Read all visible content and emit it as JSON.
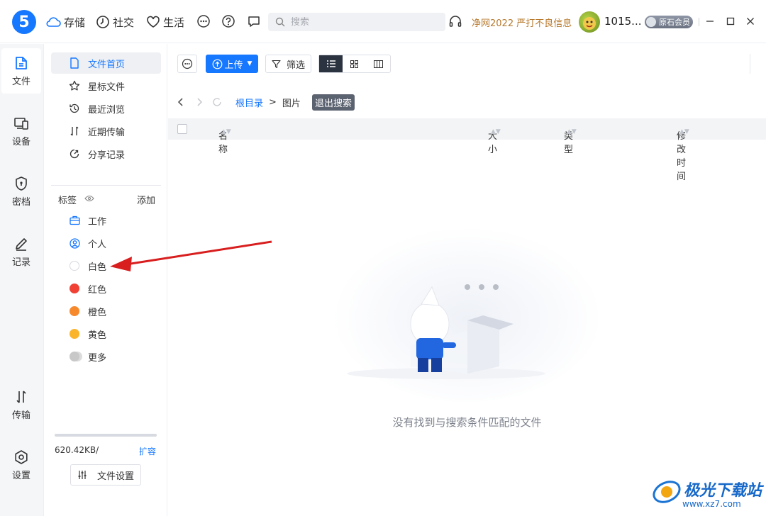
{
  "header": {
    "logo": "5",
    "nav": [
      {
        "label": "存储",
        "icon": "cloud-icon"
      },
      {
        "label": "社交",
        "icon": "clock-icon"
      },
      {
        "label": "生活",
        "icon": "heart-icon"
      }
    ],
    "search_placeholder": "搜索",
    "promo": "净网2022 严打不良信息",
    "username": "1015...",
    "member_badge": "原石会员"
  },
  "rail": {
    "items": [
      {
        "label": "文件",
        "icon": "file-icon",
        "active": true
      },
      {
        "label": "设备",
        "icon": "device-icon"
      },
      {
        "label": "密档",
        "icon": "shield-icon"
      },
      {
        "label": "记录",
        "icon": "pen-icon"
      },
      {
        "label": "传输",
        "icon": "transfer-icon"
      },
      {
        "label": "设置",
        "icon": "gear-icon"
      }
    ]
  },
  "side": {
    "items": [
      {
        "label": "文件首页",
        "icon": "document-icon"
      },
      {
        "label": "星标文件",
        "icon": "star-icon"
      },
      {
        "label": "最近浏览",
        "icon": "history-icon"
      },
      {
        "label": "近期传输",
        "icon": "transfer-icon"
      },
      {
        "label": "分享记录",
        "icon": "share-icon"
      }
    ],
    "tags_title": "标签",
    "tags_add": "添加",
    "tags": [
      {
        "label": "工作",
        "icon": "briefcase-icon"
      },
      {
        "label": "个人",
        "icon": "person-icon"
      },
      {
        "label": "白色",
        "color": "#ffffff"
      },
      {
        "label": "红色",
        "color": "#f04134"
      },
      {
        "label": "橙色",
        "color": "#f7892d"
      },
      {
        "label": "黄色",
        "color": "#fbb52d"
      },
      {
        "label": "更多",
        "color": "#c8c8c8"
      }
    ],
    "storage_used": "620.42KB/",
    "expand": "扩容",
    "file_settings": "文件设置"
  },
  "toolbar": {
    "upload": "上传",
    "filter": "筛选"
  },
  "breadcrumb": {
    "root": "根目录",
    "separator": ">",
    "current": "图片",
    "exit_search": "退出搜索"
  },
  "table": {
    "columns": [
      "名称",
      "大小",
      "类型",
      "修改时间"
    ]
  },
  "empty_message": "没有找到与搜索条件匹配的文件",
  "watermark": {
    "title": "极光下载站",
    "url": "www.xz7.com"
  },
  "colors": {
    "accent": "#1677ff",
    "promo": "#b7792c",
    "arrow": "#d81e1e"
  }
}
